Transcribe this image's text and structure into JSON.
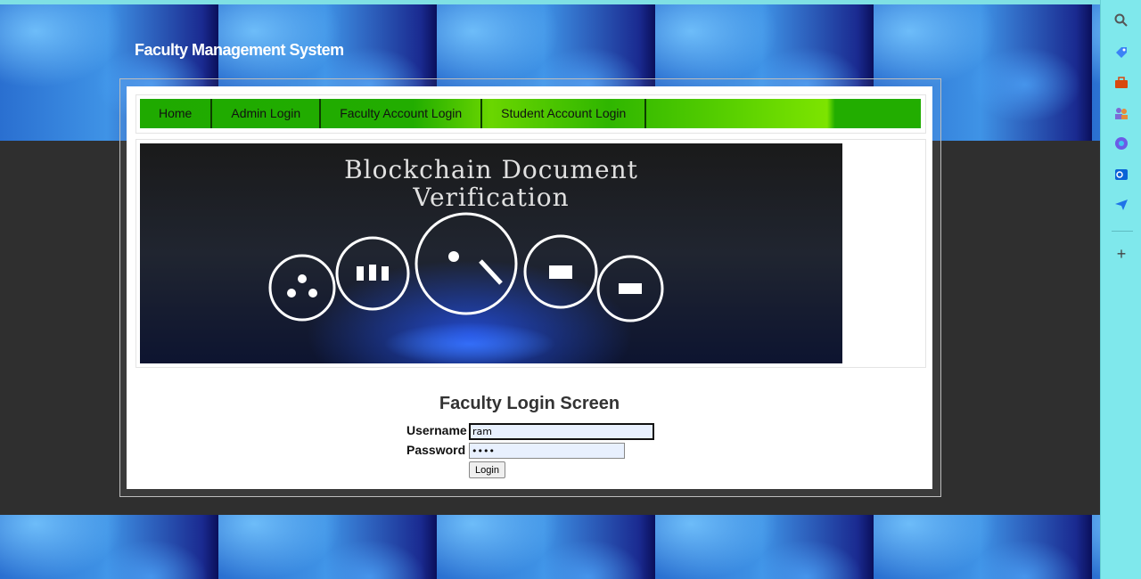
{
  "site": {
    "title": "Faculty Management System"
  },
  "nav": {
    "items": [
      {
        "label": "Home"
      },
      {
        "label": "Admin Login"
      },
      {
        "label": "Faculty Account Login"
      },
      {
        "label": "Student Account Login"
      }
    ]
  },
  "hero": {
    "line1": "Blockchain Document",
    "line2": "Verification"
  },
  "login": {
    "title": "Faculty Login Screen",
    "username_label": "Username",
    "username_value": "ram",
    "password_label": "Password",
    "password_value": "••••",
    "button_label": "Login"
  },
  "sidebar": {
    "icons": [
      "search-icon",
      "tag-icon",
      "briefcase-icon",
      "people-icon",
      "copilot-icon",
      "outlook-icon",
      "send-icon",
      "plus-icon"
    ]
  }
}
